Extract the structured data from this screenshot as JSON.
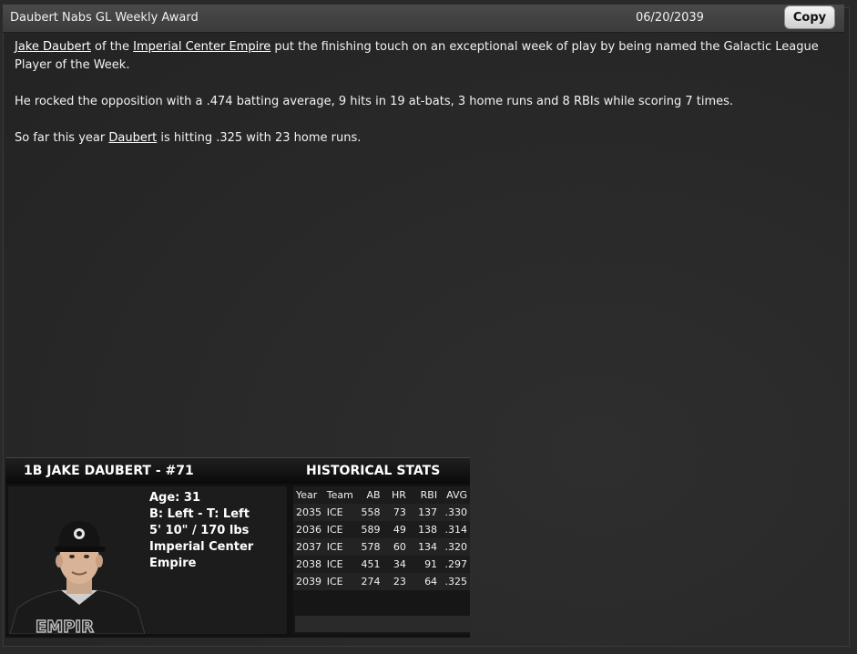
{
  "window": {
    "title": "Daubert Nabs GL Weekly Award",
    "date": "06/20/2039",
    "copy_label": "Copy"
  },
  "article": {
    "p1": {
      "player_link": "Jake Daubert",
      "text_a": " of the ",
      "team_link": "Imperial Center Empire",
      "text_b": " put the finishing touch on an exceptional week of play by being named the Galactic League Player of the Week."
    },
    "p2": "He rocked the opposition with a .474 batting average, 9 hits in 19 at-bats, 3 home runs and 8 RBIs while scoring 7 times.",
    "p3": {
      "text_a": "So far this year ",
      "player_link": "Daubert",
      "text_b": " is hitting .325 with 23 home runs."
    }
  },
  "card": {
    "player_title": "1B JAKE DAUBERT - #71",
    "hist_title": "HISTORICAL STATS",
    "age": "Age: 31",
    "bats_throws": "B: Left - T: Left",
    "height_weight": "5' 10\" / 170 lbs",
    "team": "Imperial Center Empire",
    "headers": [
      "Year",
      "Team",
      "AB",
      "HR",
      "RBI",
      "AVG"
    ],
    "rows": [
      [
        "2035",
        "ICE",
        "558",
        "73",
        "137",
        ".330"
      ],
      [
        "2036",
        "ICE",
        "589",
        "49",
        "138",
        ".314"
      ],
      [
        "2037",
        "ICE",
        "578",
        "60",
        "134",
        ".320"
      ],
      [
        "2038",
        "ICE",
        "451",
        "34",
        "91",
        ".297"
      ],
      [
        "2039",
        "ICE",
        "274",
        "23",
        "64",
        ".325"
      ]
    ]
  },
  "colors": {
    "background": "#2a2a2a",
    "titlebar": "#454545",
    "card_header": "#0f0f0f"
  }
}
